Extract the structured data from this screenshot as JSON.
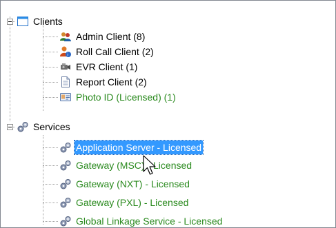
{
  "tree": {
    "groups": [
      {
        "label": "Clients",
        "icon": "window-icon",
        "expanded": true,
        "children": [
          {
            "label": "Admin Client (8)",
            "icon": "users-group-icon",
            "licensed": false
          },
          {
            "label": "Roll Call Client (2)",
            "icon": "user-roll-call-icon",
            "licensed": false
          },
          {
            "label": "EVR Client (1)",
            "icon": "camera-recorder-icon",
            "licensed": false
          },
          {
            "label": "Report Client (2)",
            "icon": "document-icon",
            "licensed": false
          },
          {
            "label": "Photo ID (Licensed) (1)",
            "icon": "id-card-icon",
            "licensed": true
          }
        ]
      },
      {
        "label": "Services",
        "icon": "gears-icon",
        "expanded": true,
        "children": [
          {
            "label": "Application Server - Licensed",
            "icon": "gears-icon",
            "licensed": true,
            "selected": true
          },
          {
            "label": "Gateway (MSC) - Licensed",
            "icon": "gears-icon",
            "licensed": true
          },
          {
            "label": "Gateway (NXT) - Licensed",
            "icon": "gears-icon",
            "licensed": true
          },
          {
            "label": "Gateway (PXL) - Licensed",
            "icon": "gears-icon",
            "licensed": true
          },
          {
            "label": "Global Linkage Service - Licensed",
            "icon": "gears-icon",
            "licensed": true
          }
        ]
      }
    ]
  },
  "colors": {
    "licensed_text": "#2a8a1e",
    "selection_bg": "#3399ff",
    "selection_text": "#ffffff"
  }
}
